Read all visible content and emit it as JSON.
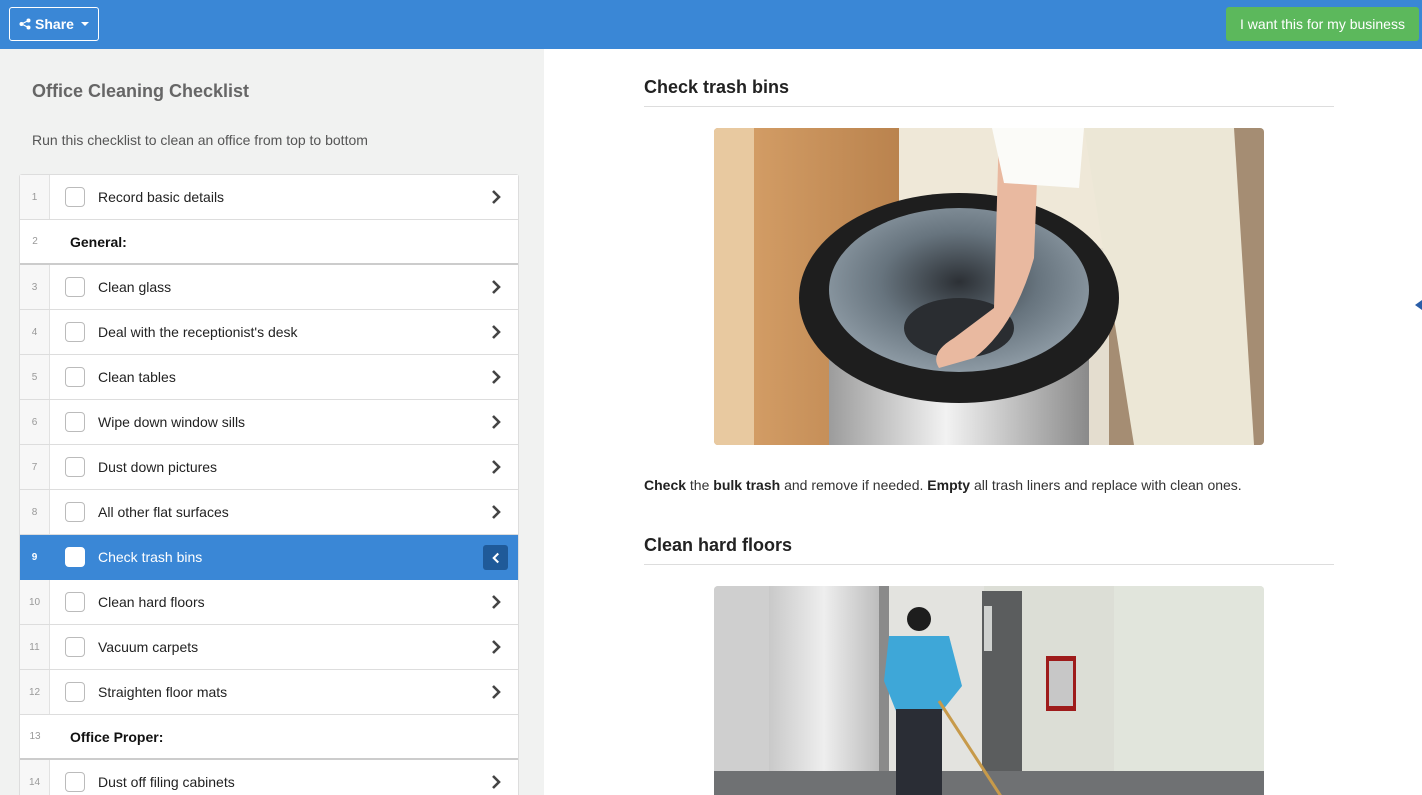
{
  "topbar": {
    "share_label": "Share",
    "business_label": "I want this for my business"
  },
  "checklist": {
    "title": "Office Cleaning Checklist",
    "description": "Run this checklist to clean an office from top to bottom",
    "items": [
      {
        "num": "1",
        "label": "Record basic details",
        "type": "task"
      },
      {
        "num": "2",
        "label": "General:",
        "type": "heading"
      },
      {
        "num": "3",
        "label": "Clean glass",
        "type": "task"
      },
      {
        "num": "4",
        "label": "Deal with the receptionist's desk",
        "type": "task"
      },
      {
        "num": "5",
        "label": "Clean tables",
        "type": "task"
      },
      {
        "num": "6",
        "label": "Wipe down window sills",
        "type": "task"
      },
      {
        "num": "7",
        "label": "Dust down pictures",
        "type": "task"
      },
      {
        "num": "8",
        "label": "All other flat surfaces",
        "type": "task"
      },
      {
        "num": "9",
        "label": "Check trash bins",
        "type": "task",
        "active": true
      },
      {
        "num": "10",
        "label": "Clean hard floors",
        "type": "task"
      },
      {
        "num": "11",
        "label": "Vacuum carpets",
        "type": "task"
      },
      {
        "num": "12",
        "label": "Straighten floor mats",
        "type": "task"
      },
      {
        "num": "13",
        "label": "Office Proper:",
        "type": "heading"
      },
      {
        "num": "14",
        "label": "Dust off filing cabinets",
        "type": "task"
      }
    ]
  },
  "content": {
    "section1": {
      "title": "Check trash bins",
      "desc": {
        "p1": "Check",
        "p2": " the ",
        "p3": "bulk trash",
        "p4": " and remove if needed. ",
        "p5": "Empty",
        "p6": " all trash liners and replace with clean ones."
      }
    },
    "section2": {
      "title": "Clean hard floors"
    }
  },
  "colors": {
    "accent": "#3a87d6",
    "business_button": "#5cb85c",
    "active_chevron_box": "#1f5a99"
  }
}
